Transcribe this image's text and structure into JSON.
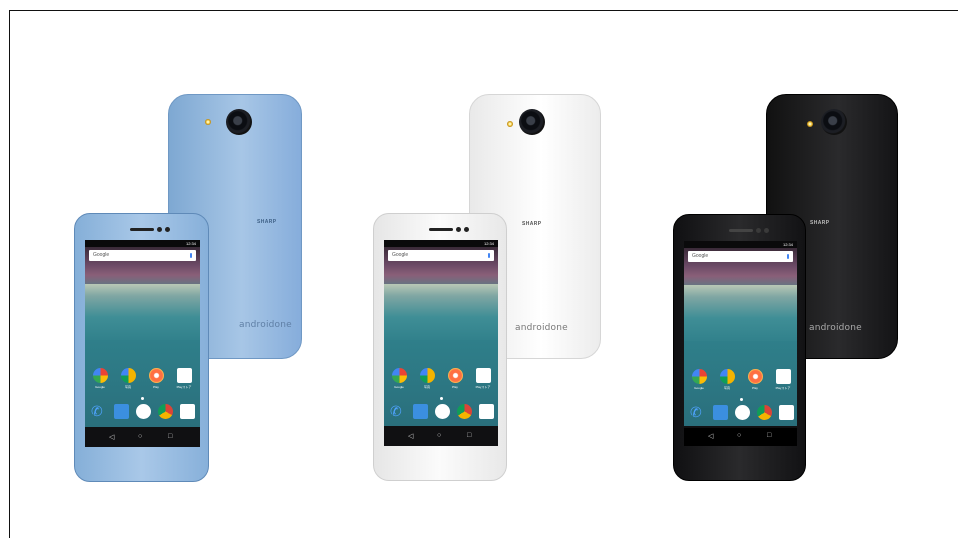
{
  "phones": [
    {
      "color_name": "blue",
      "body_color": "#8db4d9",
      "back_brand": "SHARP",
      "back_logo": "androidone",
      "status_time": "12:34",
      "search_label": "Google",
      "app_labels": [
        "Google",
        "写真",
        "Play",
        "Playストア"
      ]
    },
    {
      "color_name": "white",
      "body_color": "#f4f4f4",
      "back_brand": "SHARP",
      "back_logo": "androidone",
      "status_time": "12:34",
      "search_label": "Google",
      "app_labels": [
        "Google",
        "写真",
        "Play",
        "Playストア"
      ]
    },
    {
      "color_name": "black",
      "body_color": "#1d1d1f",
      "back_brand": "SHARP",
      "back_logo": "androidone",
      "status_time": "12:34",
      "search_label": "Google",
      "app_labels": [
        "Google",
        "写真",
        "Play",
        "Playストア"
      ]
    }
  ],
  "nav_icons": [
    "back-icon",
    "home-icon",
    "recents-icon"
  ],
  "app_icons": [
    "google-app-icon",
    "photos-app-icon",
    "play-app-icon",
    "play-store-app-icon"
  ],
  "dock_icons": [
    "phone-icon",
    "messages-icon",
    "apps-drawer-icon",
    "chrome-icon",
    "camera-app-icon"
  ]
}
